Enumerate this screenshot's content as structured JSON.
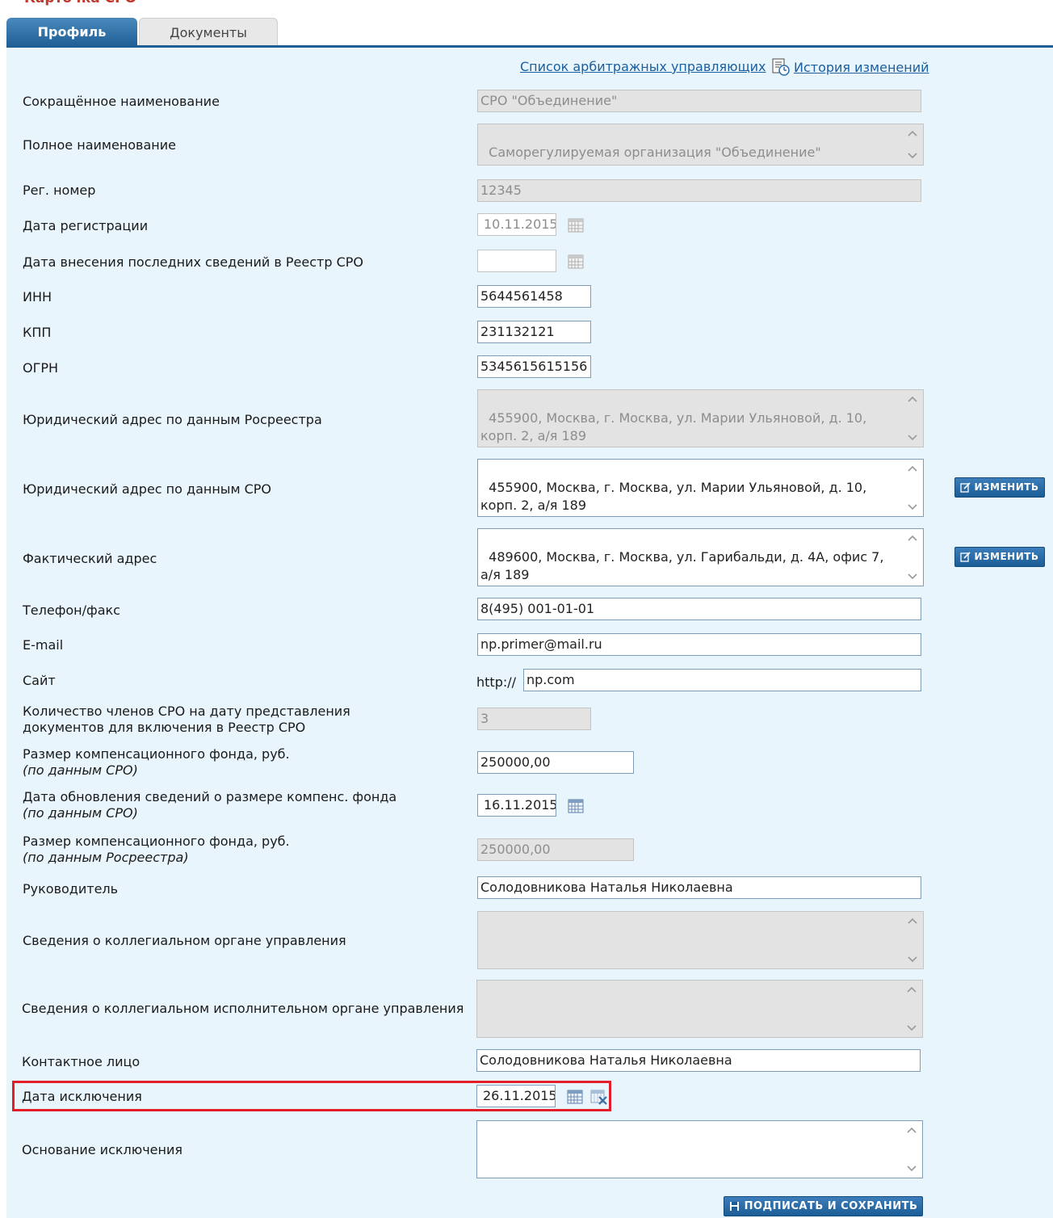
{
  "page": {
    "title": "Карточка СРО"
  },
  "tabs": [
    {
      "label": "Профиль"
    },
    {
      "label": "Документы"
    }
  ],
  "links": {
    "arbitration_managers": "Список арбитражных управляющих",
    "history": "История изменений"
  },
  "fields": {
    "short_name": {
      "label": "Сокращённое наименование",
      "value": "СРО \"Объединение\""
    },
    "full_name": {
      "label": "Полное наименование",
      "value": "Саморегулируемая организация \"Объединение\""
    },
    "reg_number": {
      "label": "Рег. номер",
      "value": "12345"
    },
    "reg_date": {
      "label": "Дата регистрации",
      "value": "10.11.2015"
    },
    "last_registry_date": {
      "label": "Дата внесения последних сведений в Реестр СРО",
      "value": ""
    },
    "inn": {
      "label": "ИНН",
      "value": "5644561458"
    },
    "kpp": {
      "label": "КПП",
      "value": "231132121"
    },
    "ogrn": {
      "label": "ОГРН",
      "value": "5345615615156"
    },
    "legal_address_rosreestr": {
      "label": "Юридический адрес по данным Росреестра",
      "value": "455900, Москва, г. Москва, ул. Марии Ульяновой, д. 10, корп. 2, а/я 189"
    },
    "legal_address_sro": {
      "label": "Юридический адрес по данным СРО",
      "value": "455900, Москва, г. Москва, ул. Марии Ульяновой, д. 10, корп. 2, а/я 189"
    },
    "actual_address": {
      "label": "Фактический адрес",
      "value": "489600, Москва, г. Москва, ул. Гарибальди, д. 4А, офис 7, а/я 189"
    },
    "phone": {
      "label": "Телефон/факс",
      "value": "8(495) 001-01-01"
    },
    "email": {
      "label": "E-mail",
      "value": "np.primer@mail.ru"
    },
    "site": {
      "label": "Сайт",
      "prefix": "http://",
      "value": "np.com"
    },
    "members_count": {
      "label_line1": "Количество членов СРО на дату представления",
      "label_line2": "документов для включения в Реестр СРО",
      "value": "3"
    },
    "comp_fund_sro": {
      "label_line1": "Размер компенсационного фонда, руб.",
      "label_line2": "(по данным СРО)",
      "value": "250000,00"
    },
    "comp_fund_update_date": {
      "label_line1": "Дата обновления сведений о размере компенс. фонда",
      "label_line2": "(по данным СРО)",
      "value": "16.11.2015"
    },
    "comp_fund_rosreestr": {
      "label_line1": "Размер компенсационного фонда, руб.",
      "label_line2": "(по данным Росреестра)",
      "value": "250000,00"
    },
    "head": {
      "label": "Руководитель",
      "value": "Солодовникова Наталья Николаевна"
    },
    "collegial_body": {
      "label": "Сведения о коллегиальном органе управления",
      "value": ""
    },
    "collegial_exec_body": {
      "label": "Сведения о коллегиальном исполнительном органе управления",
      "value": ""
    },
    "contact_person": {
      "label": "Контактное лицо",
      "value": "Солодовникова Наталья Николаевна"
    },
    "exclusion_date": {
      "label": "Дата исключения",
      "value": "26.11.2015"
    },
    "exclusion_reason": {
      "label": "Основание исключения",
      "value": ""
    }
  },
  "buttons": {
    "change": "ИЗМЕНИТЬ",
    "sign_save": "ПОДПИСАТЬ И СОХРАНИТЬ"
  },
  "colors": {
    "accent": "#1f5f95",
    "panel_bg": "#e9f5fc",
    "highlight": "#e21e2b",
    "title": "#c0392b"
  }
}
